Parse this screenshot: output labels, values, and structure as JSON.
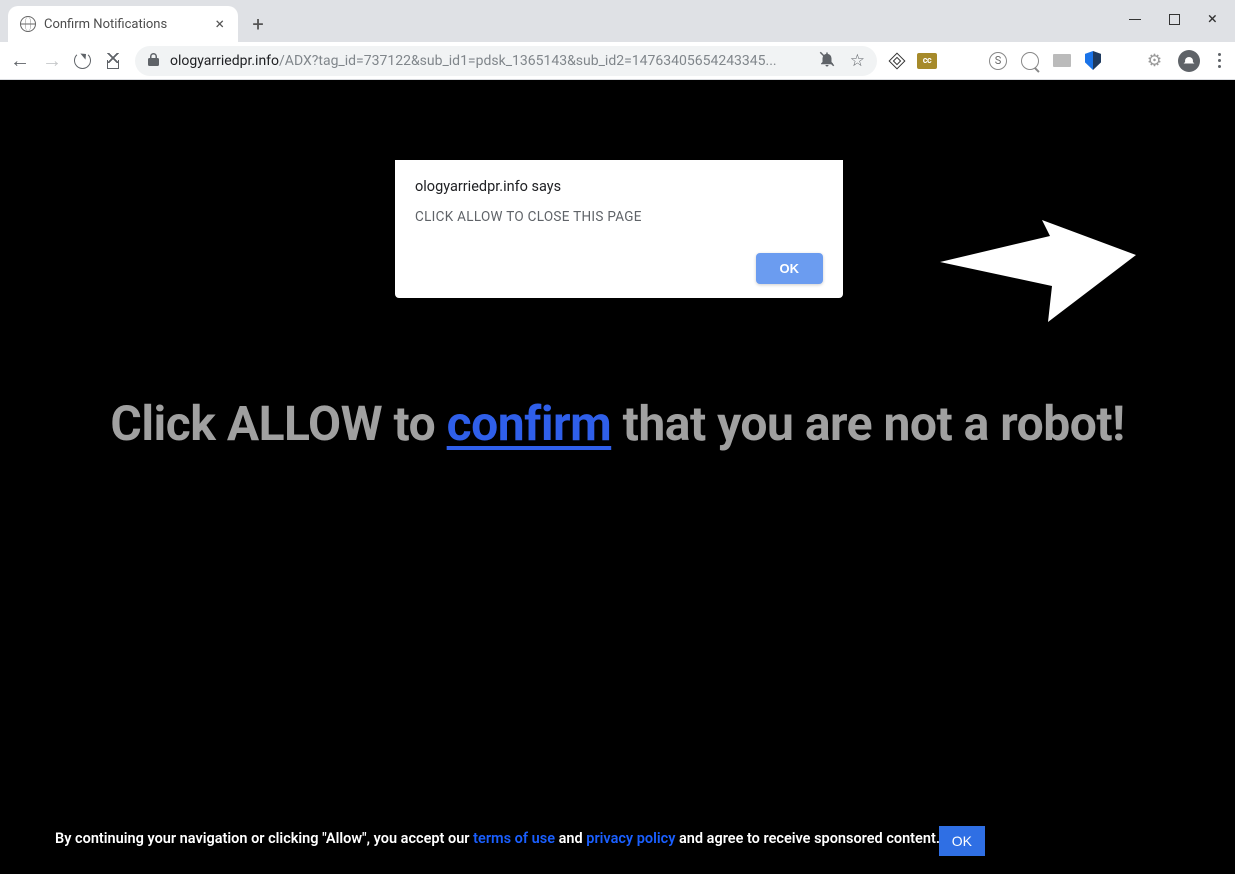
{
  "window": {
    "tab_title": "Confirm Notifications"
  },
  "omnibox": {
    "host": "ologyarriedpr.info",
    "path": "/ADX?tag_id=737122&sub_id1=pdsk_1365143&sub_id2=14763405654243345..."
  },
  "js_dialog": {
    "host_line": "ologyarriedpr.info says",
    "message": "CLICK ALLOW TO CLOSE THIS PAGE",
    "ok_label": "OK"
  },
  "headline": {
    "pre": "Click ALLOW to ",
    "link": "confirm",
    "post": " that you are not a robot!"
  },
  "footer": {
    "part1": "By continuing your navigation or clicking \"Allow\", you accept our ",
    "terms": "terms of use",
    "part2": " and ",
    "privacy": "privacy policy",
    "part3": " and agree to receive sponsored content.",
    "ok_label": "OK"
  }
}
